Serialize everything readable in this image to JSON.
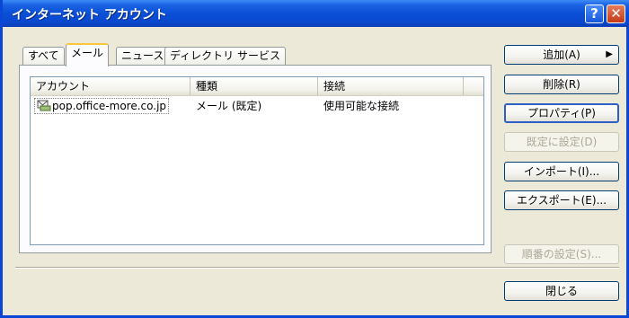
{
  "window": {
    "title": "インターネット アカウント"
  },
  "titlebar": {
    "help_glyph": "?",
    "close_glyph": "✕"
  },
  "tabs": [
    {
      "label": "すべて"
    },
    {
      "label": "メール"
    },
    {
      "label": "ニュース"
    },
    {
      "label": "ディレクトリ サービス"
    }
  ],
  "active_tab": "メール",
  "list": {
    "columns": [
      "アカウント",
      "種類",
      "接続"
    ],
    "rows": [
      {
        "account": "pop.office-more.co.jp",
        "type": "メール (既定)",
        "connection": "使用可能な接続",
        "icon": "mail-server-icon"
      }
    ]
  },
  "buttons": {
    "add": "追加(A)",
    "add_arrow": "▶",
    "delete": "削除(R)",
    "properties": "プロパティ(P)",
    "set_default": "既定に設定(D)",
    "import": "インポート(I)...",
    "export": "エクスポート(E)...",
    "order": "順番の設定(S)...",
    "close": "閉じる"
  },
  "colors": {
    "titlebar": "#0a4fd6",
    "dialog_bg": "#ece9d8",
    "tab_highlight": "#ffc83c"
  }
}
